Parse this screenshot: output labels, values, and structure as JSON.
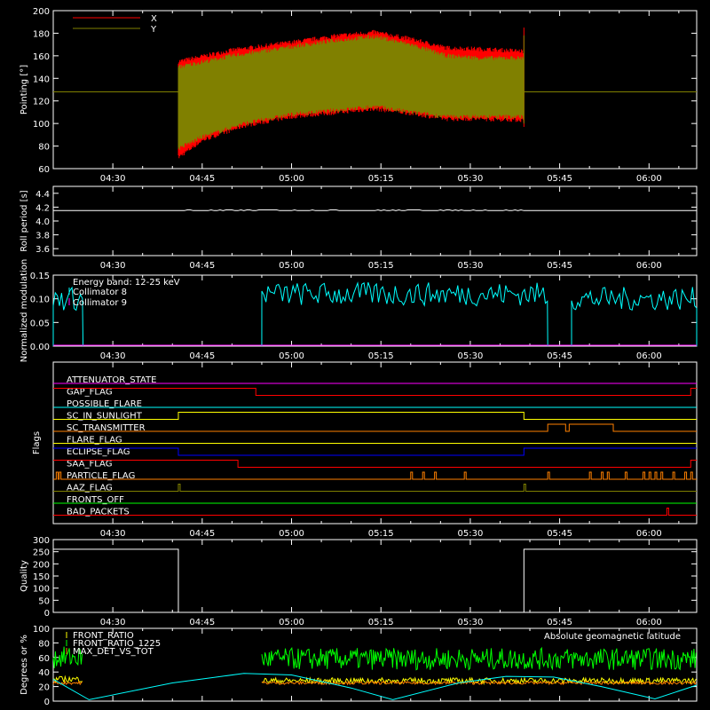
{
  "time_ticks": [
    "04:30",
    "04:45",
    "05:00",
    "05:15",
    "05:30",
    "05:45",
    "06:00"
  ],
  "chart_data": [
    {
      "type": "line",
      "ylabel": "Pointing [°]",
      "ylim": [
        60,
        200
      ],
      "yticks": [
        60,
        80,
        100,
        120,
        140,
        160,
        180,
        200
      ],
      "xlim_minutes": [
        20,
        128
      ],
      "legend": "top-left",
      "series": [
        {
          "name": "X",
          "color": "#ff0000",
          "baseline": 128,
          "active_start": 41,
          "active_end": 99,
          "upper": [
            [
              41,
              155
            ],
            [
              50,
              165
            ],
            [
              60,
              172
            ],
            [
              68,
              178
            ],
            [
              74,
              181
            ],
            [
              80,
              175
            ],
            [
              86,
              167
            ],
            [
              92,
              166
            ],
            [
              99,
              164
            ]
          ],
          "lower": [
            [
              41,
              70
            ],
            [
              45,
              85
            ],
            [
              52,
              98
            ],
            [
              60,
              106
            ],
            [
              68,
              110
            ],
            [
              74,
              113
            ],
            [
              80,
              109
            ],
            [
              86,
              104
            ],
            [
              92,
              104
            ],
            [
              99,
              103
            ]
          ]
        },
        {
          "name": "Y",
          "color": "#808000",
          "baseline": 128,
          "active_start": 41,
          "active_end": 99,
          "upper": [
            [
              41,
              150
            ],
            [
              50,
              160
            ],
            [
              60,
              168
            ],
            [
              68,
              174
            ],
            [
              74,
              177
            ],
            [
              80,
              170
            ],
            [
              86,
              160
            ],
            [
              92,
              158
            ],
            [
              99,
              158
            ]
          ],
          "lower": [
            [
              41,
              78
            ],
            [
              45,
              88
            ],
            [
              52,
              100
            ],
            [
              60,
              108
            ],
            [
              68,
              112
            ],
            [
              74,
              115
            ],
            [
              80,
              110
            ],
            [
              86,
              106
            ],
            [
              92,
              106
            ],
            [
              99,
              106
            ]
          ]
        }
      ]
    },
    {
      "type": "line",
      "ylabel": "Roll period [s]",
      "ylim": [
        3.5,
        4.5
      ],
      "yticks": [
        3.6,
        3.8,
        4.0,
        4.2,
        4.4
      ],
      "series": [
        {
          "name": "",
          "color": "#ffffff",
          "value": 4.15
        }
      ]
    },
    {
      "type": "line",
      "ylabel": "Normalized modulation",
      "ylim": [
        0,
        0.15
      ],
      "yticks": [
        0.0,
        0.05,
        0.1,
        0.15
      ],
      "annotation": "Energy band: 12-25 keV",
      "series": [
        {
          "name": "Collimator 8",
          "color": "#00ffff",
          "segments": [
            [
              20,
              25,
              0.1
            ],
            [
              55,
              103,
              0.11
            ],
            [
              107,
              128,
              0.1
            ]
          ]
        },
        {
          "name": "Collimator 9",
          "color": "#ff00ff",
          "value": 0.0
        }
      ]
    },
    {
      "type": "line",
      "ylabel": "Flags",
      "flags": [
        {
          "name": "ATTENUATOR_STATE",
          "color": "#ff00ff",
          "steps": [
            [
              20,
              0
            ]
          ]
        },
        {
          "name": "GAP_FLAG",
          "color": "#ff0000",
          "steps": [
            [
              20,
              1
            ],
            [
              54,
              0
            ],
            [
              127,
              1
            ]
          ]
        },
        {
          "name": "POSSIBLE_FLARE",
          "color": "#00ffff",
          "steps": [
            [
              20,
              0
            ]
          ]
        },
        {
          "name": "SC_IN_SUNLIGHT",
          "color": "#ffff00",
          "steps": [
            [
              20,
              0
            ],
            [
              41,
              1
            ],
            [
              99,
              0
            ]
          ]
        },
        {
          "name": "SC_TRANSMITTER",
          "color": "#ff8000",
          "steps": [
            [
              20,
              0
            ],
            [
              103,
              1
            ],
            [
              106,
              0
            ],
            [
              106.6,
              1
            ],
            [
              114,
              0
            ]
          ]
        },
        {
          "name": "FLARE_FLAG",
          "color": "#ffff00",
          "steps": [
            [
              20,
              0
            ]
          ]
        },
        {
          "name": "ECLIPSE_FLAG",
          "color": "#0000ff",
          "steps": [
            [
              20,
              1
            ],
            [
              41,
              0
            ],
            [
              99,
              1
            ]
          ]
        },
        {
          "name": "SAA_FLAG",
          "color": "#ff0000",
          "steps": [
            [
              20,
              1
            ],
            [
              51,
              0
            ],
            [
              127,
              1
            ]
          ]
        },
        {
          "name": "PARTICLE_FLAG",
          "color": "#ff8000",
          "spikes": [
            20.5,
            21,
            80,
            82,
            84,
            89,
            103,
            110,
            112,
            113,
            116,
            119,
            120,
            121,
            122,
            124,
            126,
            127
          ]
        },
        {
          "name": "AAZ_FLAG",
          "color": "#808000",
          "spikes": [
            41,
            99
          ]
        },
        {
          "name": "FRONTS_OFF",
          "color": "#00ff00",
          "steps": [
            [
              20,
              0
            ]
          ]
        },
        {
          "name": "BAD_PACKETS",
          "color": "#ff0000",
          "spikes": [
            123
          ]
        }
      ]
    },
    {
      "type": "line",
      "ylabel": "Quality",
      "ylim": [
        0,
        300
      ],
      "yticks": [
        0,
        50,
        100,
        150,
        200,
        250,
        300
      ],
      "series": [
        {
          "name": "",
          "color": "#ffffff",
          "segments": [
            [
              20,
              41,
              260
            ],
            [
              41,
              99,
              0
            ],
            [
              99,
              128,
              260
            ]
          ]
        }
      ]
    },
    {
      "type": "line",
      "ylabel": "Degrees or %",
      "ylim": [
        0,
        100
      ],
      "yticks": [
        0,
        20,
        40,
        60,
        80,
        100
      ],
      "annotation": "Absolute geomagnetic latitude",
      "series": [
        {
          "name": "FRONT_RATIO",
          "color": "#ffff00",
          "segments": [
            [
              20,
              25,
              30
            ],
            [
              55,
              128,
              28
            ]
          ]
        },
        {
          "name": "FRONT_RATIO_1225",
          "color": "#00ff00",
          "segments": [
            [
              20,
              25,
              60
            ],
            [
              55,
              128,
              58
            ]
          ]
        },
        {
          "name": "MAX_DET_VS_TOT",
          "color": "#ff8000",
          "segments": [
            [
              20,
              25,
              25
            ],
            [
              55,
              128,
              25
            ]
          ]
        },
        {
          "name": "Absolute geomagnetic latitude",
          "color": "#00ffff",
          "points": [
            [
              20,
              30
            ],
            [
              26,
              2
            ],
            [
              40,
              25
            ],
            [
              52,
              38
            ],
            [
              60,
              36
            ],
            [
              70,
              18
            ],
            [
              77,
              2
            ],
            [
              88,
              25
            ],
            [
              96,
              34
            ],
            [
              104,
              33
            ],
            [
              112,
              20
            ],
            [
              121,
              3
            ],
            [
              128,
              22
            ]
          ]
        }
      ]
    }
  ]
}
